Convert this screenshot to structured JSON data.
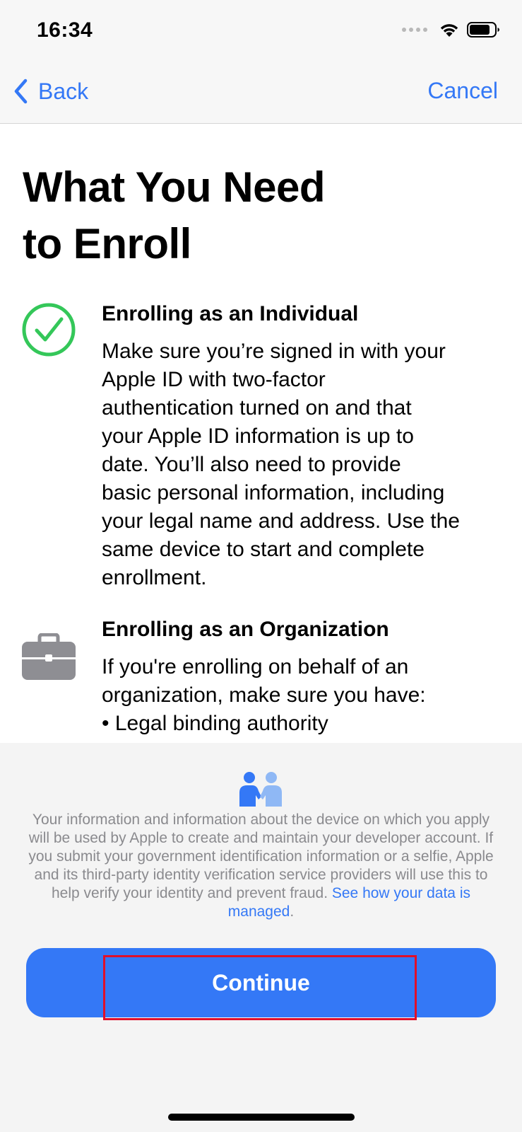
{
  "status_bar": {
    "time": "16:34"
  },
  "nav": {
    "back_label": "Back",
    "cancel_label": "Cancel"
  },
  "page": {
    "title_line1": "What You Need",
    "title_line2": "to Enroll"
  },
  "sections": [
    {
      "icon": "checkmark-circle-icon",
      "heading": "Enrolling as an Individual",
      "lines": [
        "Make sure you’re signed in with your",
        "Apple ID with two-factor",
        "authentication turned on and that",
        "your Apple ID information is up to",
        "date. You’ll also need to provide",
        "basic personal information, including",
        "your legal name and address. Use the",
        "same device to start and complete",
        "enrollment."
      ]
    },
    {
      "icon": "briefcase-icon",
      "heading": "Enrolling as an Organization",
      "lines": [
        "If you're enrolling on behalf of an",
        "organization, make sure you have:",
        "• Legal binding authority"
      ]
    }
  ],
  "privacy": {
    "icon": "privacy-handshake-icon",
    "text": "Your information and information about the device on which you apply will be used by Apple to create and maintain your developer account. If you submit your government identification information or a selfie, Apple and its third-party identity verification service providers will use this to help verify your identity and prevent fraud. ",
    "link_label": "See how your data is managed",
    "trailing": "."
  },
  "actions": {
    "continue_label": "Continue"
  },
  "colors": {
    "accent": "#3478f6",
    "check_green": "#34c759",
    "briefcase_gray": "#8e8e93",
    "highlight_red": "#e0102a"
  }
}
